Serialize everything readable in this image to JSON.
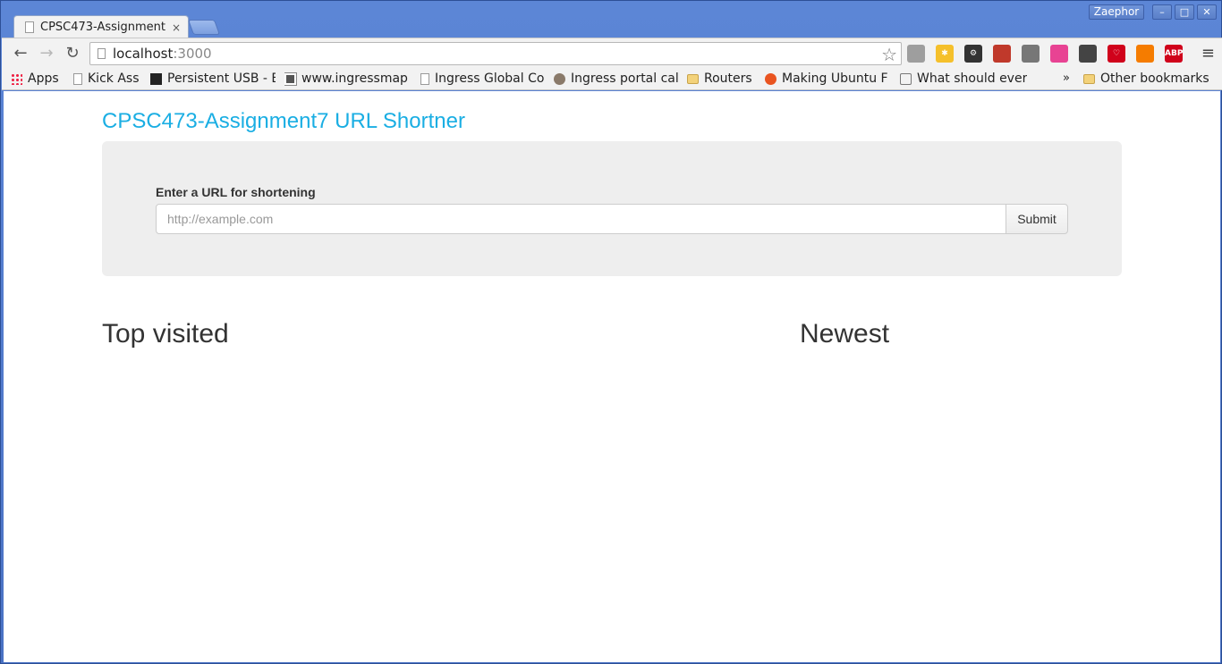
{
  "window": {
    "tab_title": "CPSC473-Assignment7 URL Shortner",
    "tab_close": "×",
    "profile_name": "Zaephor",
    "minimize": "–",
    "maximize": "□",
    "close": "✕"
  },
  "toolbar": {
    "back": "←",
    "forward": "→",
    "reload": "↻",
    "url_host": "localhost",
    "url_port": ":3000",
    "star": "☆",
    "menu": "≡",
    "extensions": [
      {
        "name": "hangouts-icon",
        "color": "#9e9e9e",
        "glyph": ""
      },
      {
        "name": "extension-yellow-icon",
        "color": "#f5c02b",
        "glyph": "✱"
      },
      {
        "name": "gear-extension-icon",
        "color": "#333333",
        "glyph": "⚙"
      },
      {
        "name": "extension-red-icon",
        "color": "#c0392b",
        "glyph": ""
      },
      {
        "name": "cast-icon",
        "color": "#777777",
        "glyph": ""
      },
      {
        "name": "color-wheel-icon",
        "color": "#e84393",
        "glyph": ""
      },
      {
        "name": "mask-icon",
        "color": "#444444",
        "glyph": ""
      },
      {
        "name": "heart-icon",
        "color": "#d0021b",
        "glyph": "♡"
      },
      {
        "name": "analytics-icon",
        "color": "#f57c00",
        "glyph": ""
      },
      {
        "name": "adblock-icon",
        "color": "#d0021b",
        "glyph": "ABP"
      }
    ]
  },
  "bookmarks": {
    "items": [
      {
        "label": "Apps"
      },
      {
        "label": "Kick Ass"
      },
      {
        "label": "Persistent USB - E"
      },
      {
        "label": "www.ingressmap"
      },
      {
        "label": "Ingress Global Co"
      },
      {
        "label": "Ingress portal cal"
      },
      {
        "label": "Routers"
      },
      {
        "label": "Making Ubuntu F"
      },
      {
        "label": "What should ever"
      }
    ],
    "overflow": "»",
    "other": "Other bookmarks"
  },
  "page": {
    "title": "CPSC473-Assignment7 URL Shortner",
    "form_label": "Enter a URL for shortening",
    "input_placeholder": "http://example.com",
    "input_value": "",
    "submit_label": "Submit",
    "top_visited_heading": "Top visited",
    "newest_heading": "Newest"
  }
}
